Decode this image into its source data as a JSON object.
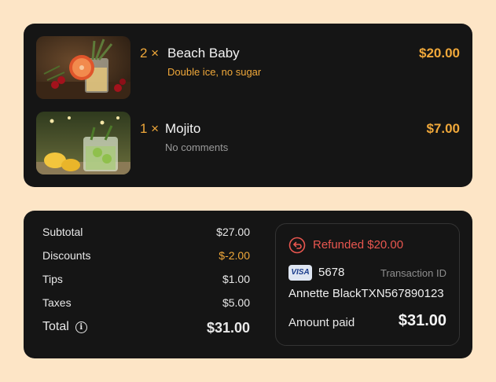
{
  "order_items": [
    {
      "quantity": "2 ×",
      "name": "Beach Baby",
      "note": "Double ice, no sugar",
      "price": "$20.00",
      "image": "beach-baby-cocktail-photo"
    },
    {
      "quantity": "1 ×",
      "name": "Mojito",
      "note": "No comments",
      "price": "$7.00",
      "image": "mojito-cocktail-photo"
    }
  ],
  "summary": {
    "subtotal_label": "Subtotal",
    "subtotal_value": "$27.00",
    "discounts_label": "Discounts",
    "discounts_value": "$-2.00",
    "tips_label": "Tips",
    "tips_value": "$1.00",
    "taxes_label": "Taxes",
    "taxes_value": "$5.00",
    "total_label": "Total",
    "total_value": "$31.00",
    "info_icon": "info-icon"
  },
  "payment": {
    "refund_icon": "refund-icon",
    "refund_text": "Refunded $20.00",
    "card_brand": "VISA",
    "card_last4": "5678",
    "transaction_label": "Transaction ID",
    "holder_and_txn": "Annette BlackTXN567890123",
    "amount_paid_label": "Amount paid",
    "amount_paid_value": "$31.00"
  },
  "colors": {
    "background": "#fde5c6",
    "card": "#151515",
    "accent": "#f0a83a",
    "refund": "#e8564f",
    "muted": "#8e8e8e"
  }
}
